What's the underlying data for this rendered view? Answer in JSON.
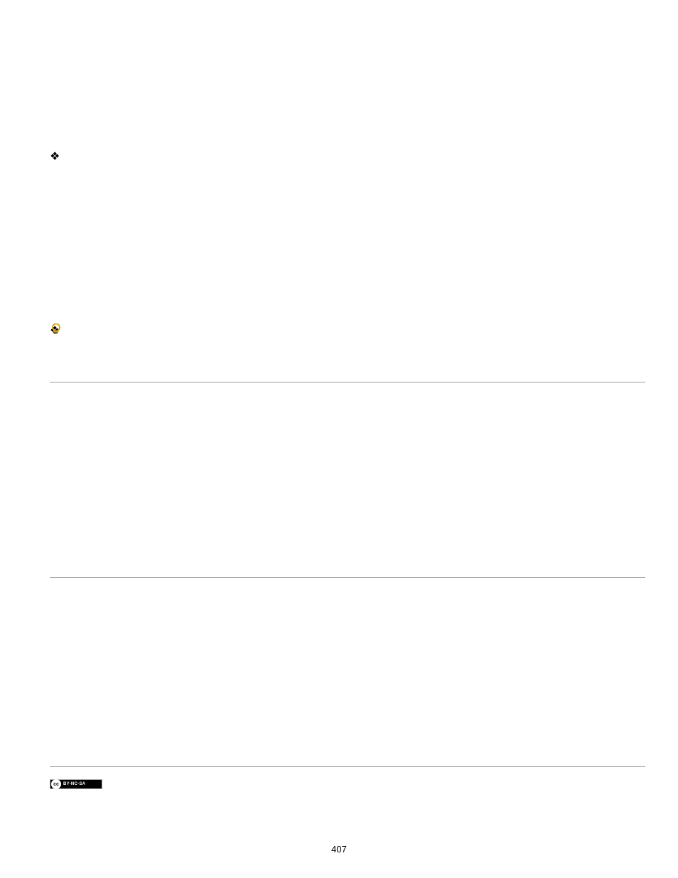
{
  "page_number": "407",
  "cc_badge": {
    "cc_text": "cc",
    "license_text": "BY-NC-SA"
  }
}
